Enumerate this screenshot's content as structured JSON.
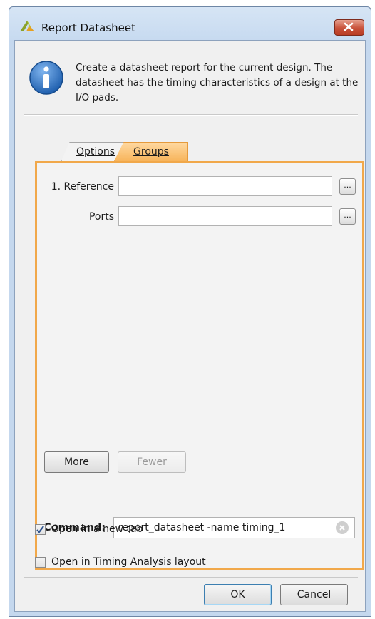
{
  "window": {
    "title": "Report Datasheet",
    "description": "Create a datasheet report for the current design. The datasheet has the timing characteristics of a design at the I/O pads."
  },
  "tabs": [
    {
      "label": "Options",
      "active": false
    },
    {
      "label": "Groups",
      "active": true
    }
  ],
  "groups": {
    "reference_label": "1. Reference",
    "reference_value": "",
    "ports_label": "Ports",
    "ports_value": "",
    "browse_label": "...",
    "more_label": "More",
    "fewer_label": "Fewer"
  },
  "command": {
    "label": "Command:",
    "value": "report_datasheet -name timing_1"
  },
  "options": {
    "open_new_tab_label": "Open in a new tab",
    "open_new_tab_checked": true,
    "open_timing_layout_label": "Open in Timing Analysis layout",
    "open_timing_layout_checked": false
  },
  "buttons": {
    "ok": "OK",
    "cancel": "Cancel"
  },
  "colors": {
    "accent_tab": "#f7b45b",
    "panel_border": "#f1a84a",
    "close_button": "#c8513a",
    "info_icon": "#1f5fae"
  }
}
